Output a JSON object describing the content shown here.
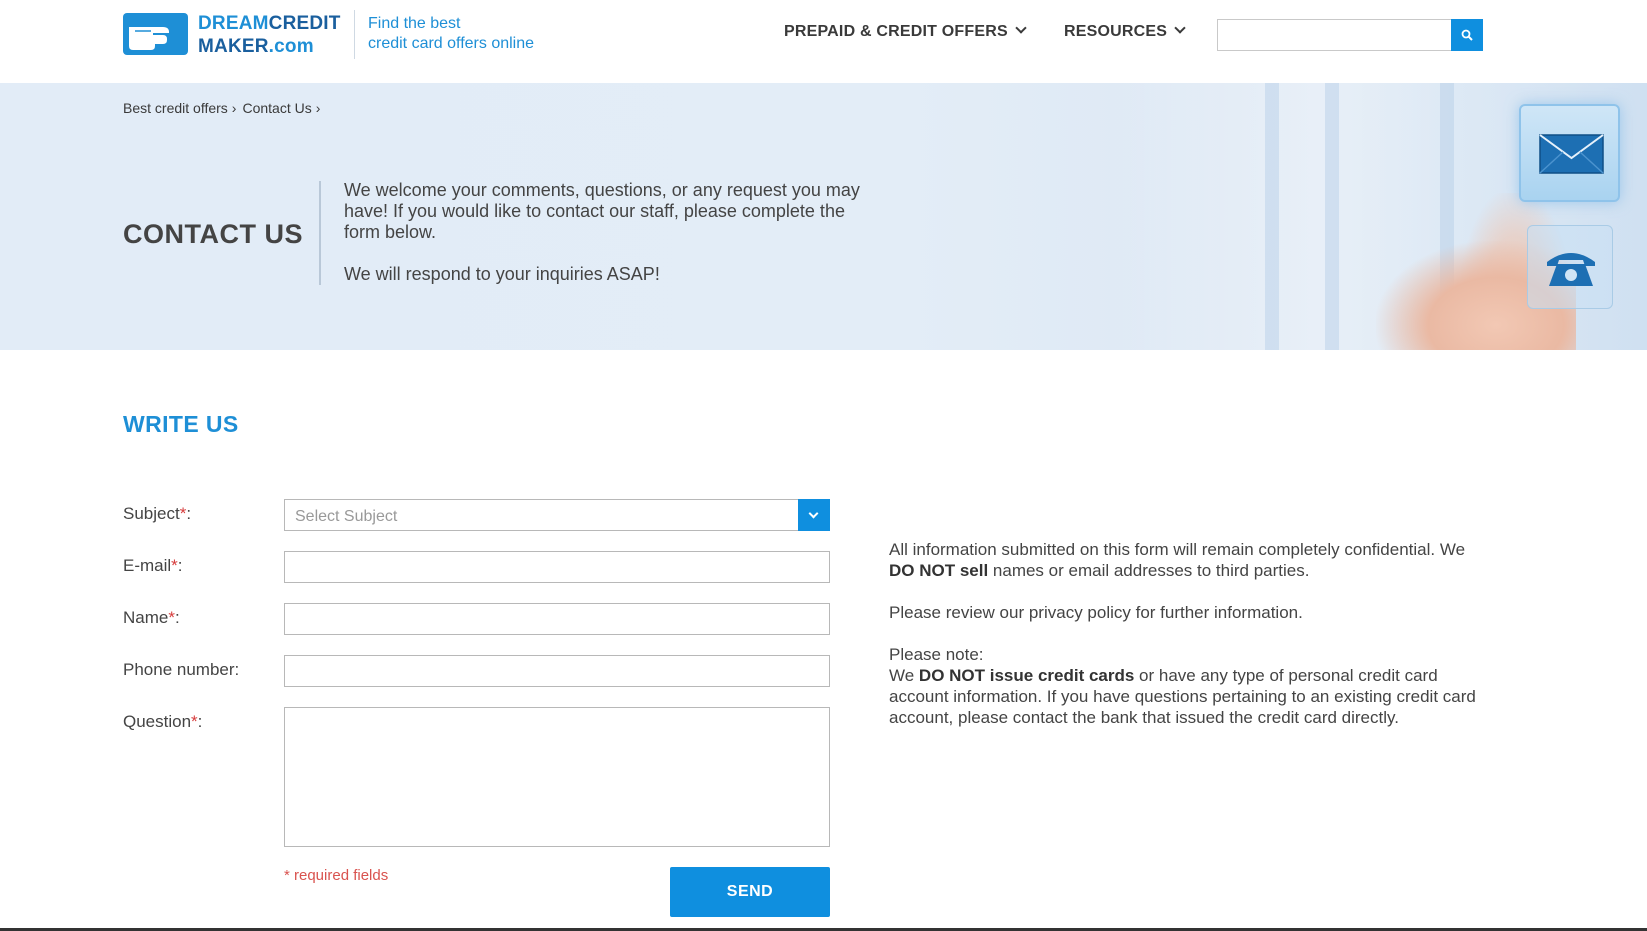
{
  "header": {
    "logo": {
      "line1_a": "DREAM",
      "line1_b": "CREDIT",
      "line2_a": "MAKER",
      "line2_b": ".com"
    },
    "tagline": {
      "line1": "Find the best",
      "line2": "credit card offers online"
    },
    "nav": [
      {
        "label": "PREPAID & CREDIT OFFERS",
        "icon": "chevron-down-icon"
      },
      {
        "label": "RESOURCES",
        "icon": "chevron-down-icon"
      }
    ],
    "search": {
      "placeholder": "",
      "button_icon": "search-icon"
    }
  },
  "hero": {
    "breadcrumb": [
      "Best credit offers",
      "Contact Us"
    ],
    "breadcrumb_separator": "›",
    "title": "CONTACT US",
    "intro": "We welcome your comments, questions, or any request you may have! If you would like to contact our staff, please complete the form below.",
    "response": "We will respond to your inquiries ASAP!",
    "icons": [
      "envelope-icon",
      "telephone-icon"
    ]
  },
  "form": {
    "section_title": "WRITE US",
    "fields": [
      {
        "label": "Subject",
        "required": true,
        "type": "select",
        "value": "Select Subject"
      },
      {
        "label": "E-mail",
        "required": true,
        "type": "text",
        "value": ""
      },
      {
        "label": "Name",
        "required": true,
        "type": "text",
        "value": ""
      },
      {
        "label": "Phone number",
        "required": false,
        "type": "text",
        "value": ""
      },
      {
        "label": "Question",
        "required": true,
        "type": "textarea",
        "value": ""
      }
    ],
    "required_mark": "*",
    "label_suffix": ":",
    "required_note": "* required fields",
    "send_label": "SEND"
  },
  "info": {
    "p1_a": "All information submitted on this form will remain completely confidential. We ",
    "p1_bold": "DO NOT sell",
    "p1_b": " names or email addresses to third parties.",
    "p2": "Please review our privacy policy for further information.",
    "p3_heading": "Please note:",
    "p3_a": "We ",
    "p3_bold": "DO NOT issue credit cards",
    "p3_b": " or have any type of personal credit card account information. If you have questions pertaining to an existing credit card account, please contact the bank that issued the credit card directly."
  },
  "colors": {
    "brand_blue": "#1e8fd6",
    "button_blue": "#0f8fdf",
    "hero_bg": "#e2ecf7",
    "required_red": "#d63b3b"
  }
}
